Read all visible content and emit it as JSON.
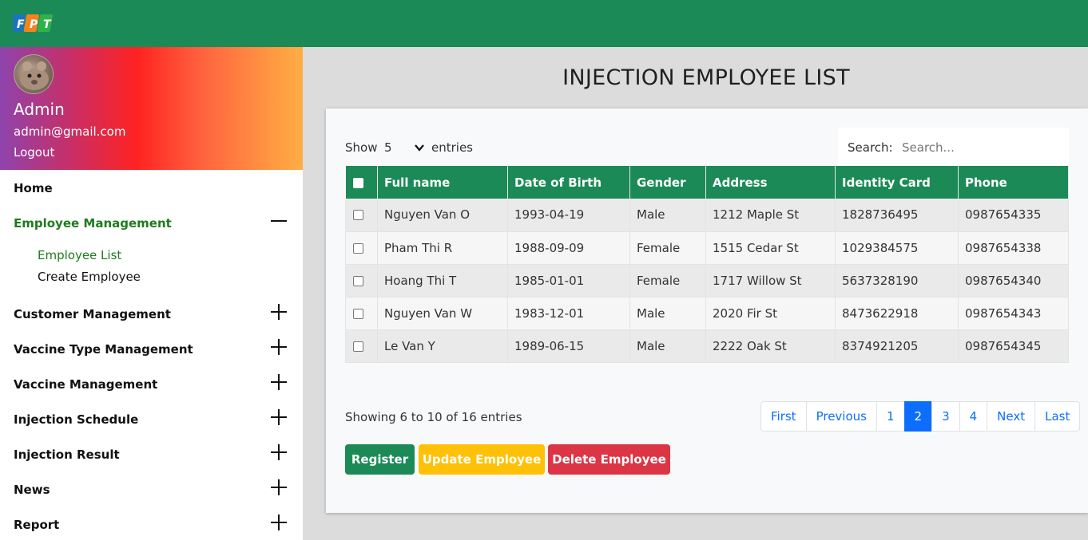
{
  "header": {
    "logo_text": "FPT"
  },
  "profile": {
    "name": "Admin",
    "email": "admin@gmail.com",
    "logout": "Logout"
  },
  "sidebar": {
    "items": [
      {
        "label": "Home"
      },
      {
        "label": "Employee Management",
        "expanded": true,
        "subitems": [
          {
            "label": "Employee List"
          },
          {
            "label": "Create Employee"
          }
        ]
      },
      {
        "label": "Customer Management"
      },
      {
        "label": "Vaccine Type Management"
      },
      {
        "label": "Vaccine Management"
      },
      {
        "label": "Injection Schedule"
      },
      {
        "label": "Injection Result"
      },
      {
        "label": "News"
      },
      {
        "label": "Report"
      }
    ]
  },
  "page": {
    "title": "INJECTION EMPLOYEE LIST"
  },
  "list_controls": {
    "show_label": "Show",
    "entries_value": "5",
    "entries_label": "entries",
    "search_label": "Search:",
    "search_placeholder": "Search..."
  },
  "table": {
    "columns": [
      "Full name",
      "Date of Birth",
      "Gender",
      "Address",
      "Identity Card",
      "Phone"
    ],
    "rows": [
      [
        "Nguyen Van O",
        "1993-04-19",
        "Male",
        "1212 Maple St",
        "1828736495",
        "0987654335"
      ],
      [
        "Pham Thi R",
        "1988-09-09",
        "Female",
        "1515 Cedar St",
        "1029384575",
        "0987654338"
      ],
      [
        "Hoang Thi T",
        "1985-01-01",
        "Female",
        "1717 Willow St",
        "5637328190",
        "0987654340"
      ],
      [
        "Nguyen Van W",
        "1983-12-01",
        "Male",
        "2020 Fir St",
        "8473622918",
        "0987654343"
      ],
      [
        "Le Van Y",
        "1989-06-15",
        "Male",
        "2222 Oak St",
        "8374921205",
        "0987654345"
      ]
    ]
  },
  "footer": {
    "showing": "Showing 6 to 10 of 16 entries",
    "pagination": [
      "First",
      "Previous",
      "1",
      "2",
      "3",
      "4",
      "Next",
      "Last"
    ],
    "current_page": "2"
  },
  "actions": {
    "register": "Register",
    "update": "Update Employee",
    "delete": "Delete Employee"
  },
  "colors": {
    "brand_green": "#1b8a57",
    "active_green": "#1e7b1e",
    "update_yellow": "#ffc107",
    "delete_red": "#dc3545",
    "page_blue": "#0d6efd"
  }
}
